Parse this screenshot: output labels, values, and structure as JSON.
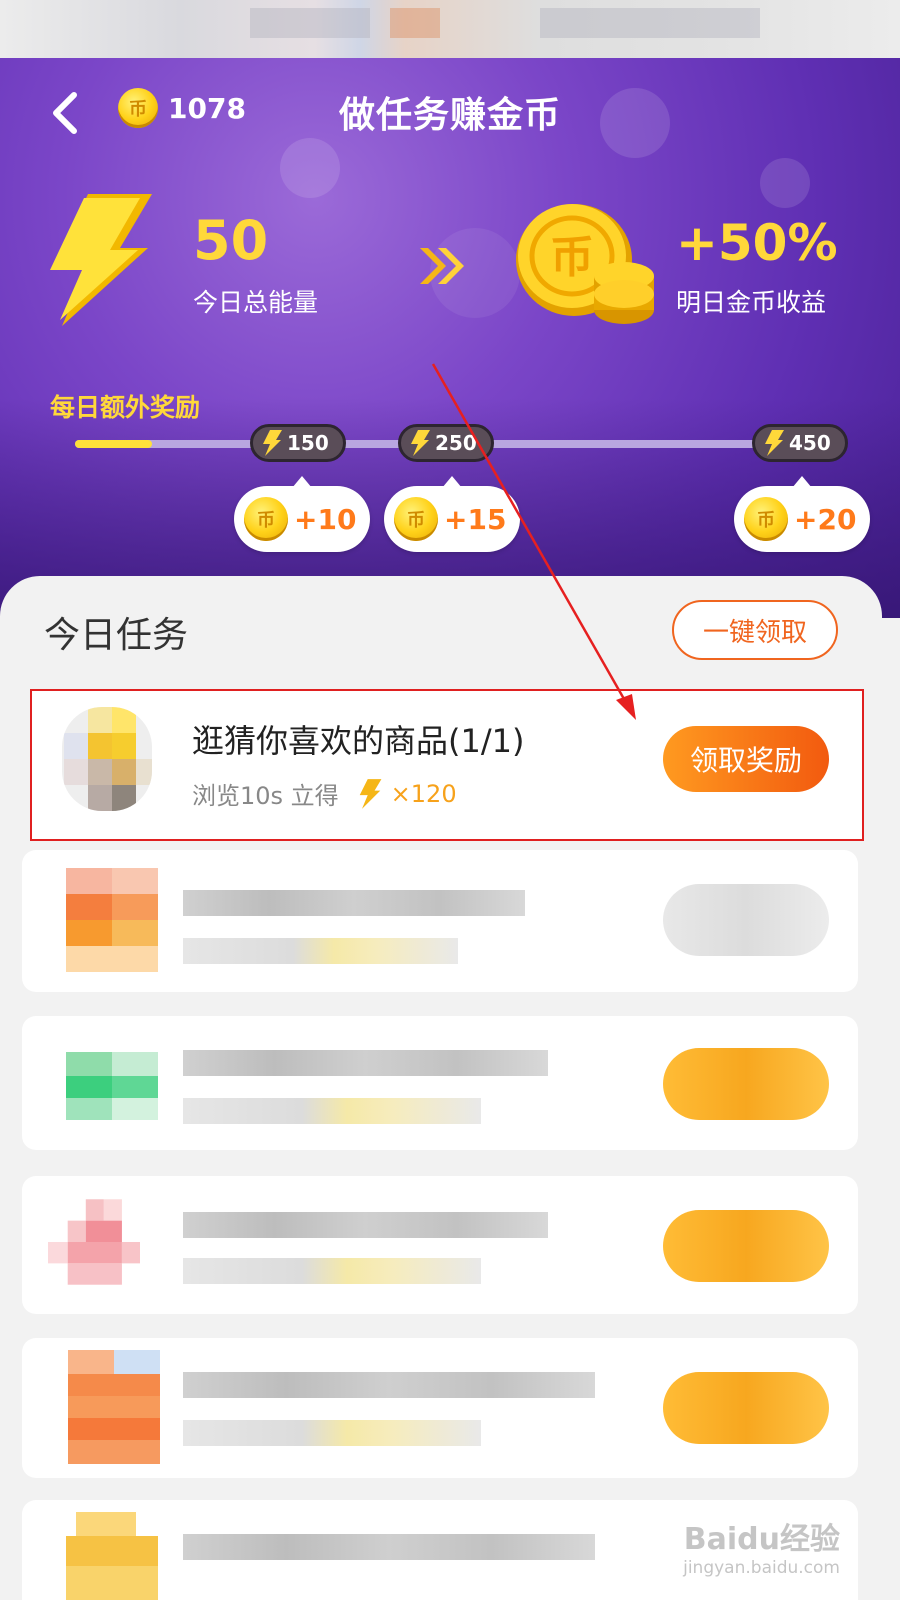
{
  "header": {
    "title": "做任务赚金币",
    "coin_balance": "1078",
    "coin_glyph": "币"
  },
  "energy": {
    "value": "50",
    "label": "今日总能量",
    "bonus_value": "+50%",
    "bonus_label": "明日金币收益"
  },
  "daily_bonus": {
    "label": "每日额外奖励",
    "progress": 0.1,
    "milestones": [
      {
        "energy": "150",
        "reward": "+10"
      },
      {
        "energy": "250",
        "reward": "+15"
      },
      {
        "energy": "450",
        "reward": "+20"
      }
    ]
  },
  "tasks_section": {
    "title": "今日任务",
    "claim_all_label": "一键领取"
  },
  "highlighted_task": {
    "title": "逛猜你喜欢的商品(1/1)",
    "subtitle": "浏览10s 立得",
    "reward_multiplier": "×120",
    "claim_label": "领取奖励"
  },
  "watermark": {
    "brand": "Baidu经验",
    "url": "jingyan.baidu.com"
  },
  "colors": {
    "accent_orange": "#f0651f",
    "energy_yellow": "#ffd83a",
    "hero_purple": "#7b46c8",
    "highlight_red": "#e02020"
  }
}
